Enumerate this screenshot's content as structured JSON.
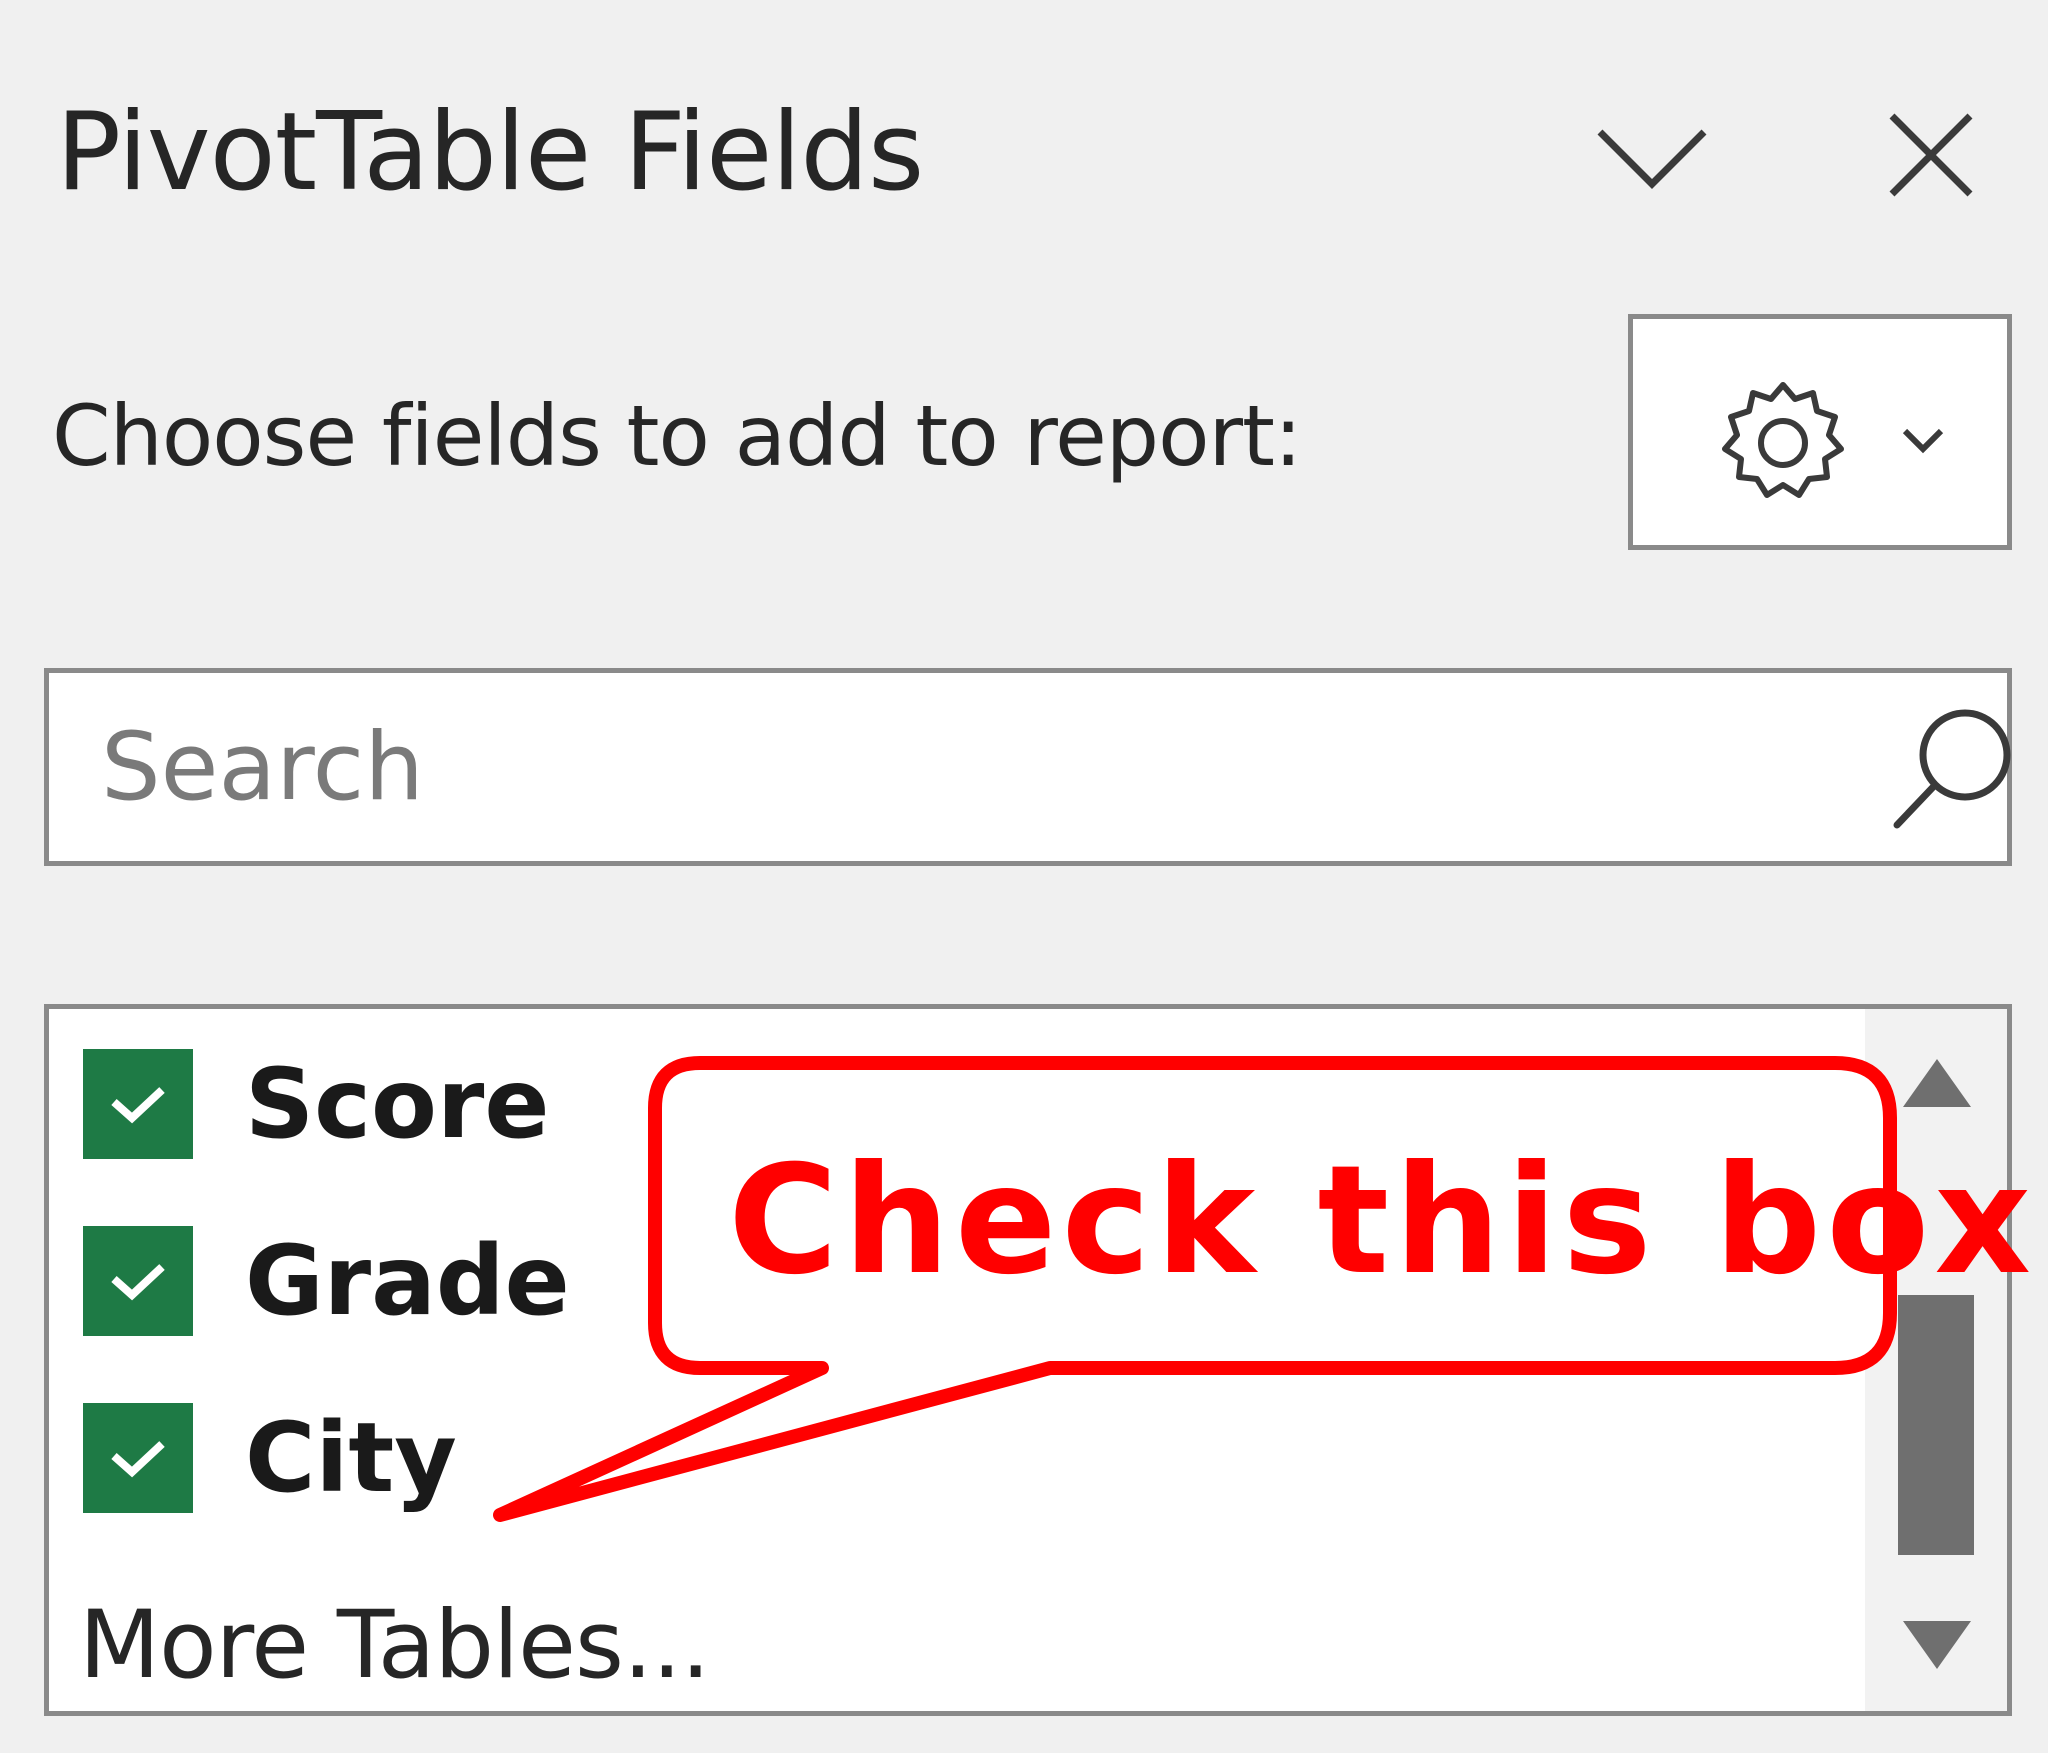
{
  "pane": {
    "title": "PivotTable Fields",
    "instruction": "Choose fields to add to report:"
  },
  "icons": {
    "collapse": "chevron-down-icon",
    "close": "close-icon",
    "tools": "gear-icon",
    "tools_dropdown": "chevron-down-icon",
    "search": "search-icon",
    "checkbox_mark": "checkmark-icon",
    "scroll_up": "triangle-up-icon",
    "scroll_down": "triangle-down-icon"
  },
  "search": {
    "value": "",
    "placeholder": "Search"
  },
  "fields": [
    {
      "label": "Score",
      "checked": true
    },
    {
      "label": "Grade",
      "checked": true
    },
    {
      "label": "City",
      "checked": true
    }
  ],
  "more_tables": "More Tables...",
  "annotation": {
    "text": "Check this box"
  },
  "colors": {
    "pane_background": "#f0f0f0",
    "checkbox_fill": "#1e7a45",
    "annotation": "#ff0000",
    "border": "#8a8a8a",
    "scroll_thumb": "#6f6f6f"
  }
}
